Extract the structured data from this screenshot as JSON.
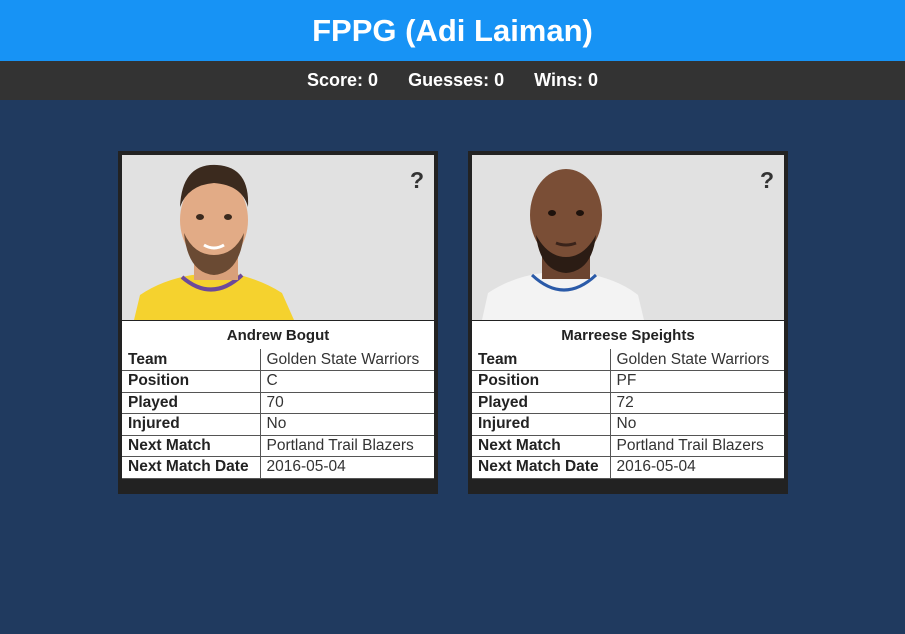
{
  "app": {
    "title": "FPPG (Adi Laiman)"
  },
  "stats": {
    "score": "Score: 0",
    "guesses": "Guesses: 0",
    "wins": "Wins: 0"
  },
  "players": [
    {
      "name": "Andrew Bogut",
      "guess_label": "?",
      "jersey_color": "#f5d22e",
      "rows": [
        {
          "label": "Team",
          "value": "Golden State Warriors"
        },
        {
          "label": "Position",
          "value": "C"
        },
        {
          "label": "Played",
          "value": "70"
        },
        {
          "label": "Injured",
          "value": "No"
        },
        {
          "label": "Next Match",
          "value": "Portland Trail Blazers"
        },
        {
          "label": "Next Match Date",
          "value": "2016-05-04"
        }
      ]
    },
    {
      "name": "Marreese Speights",
      "guess_label": "?",
      "jersey_color": "#f3f3f3",
      "rows": [
        {
          "label": "Team",
          "value": "Golden State Warriors"
        },
        {
          "label": "Position",
          "value": "PF"
        },
        {
          "label": "Played",
          "value": "72"
        },
        {
          "label": "Injured",
          "value": "No"
        },
        {
          "label": "Next Match",
          "value": "Portland Trail Blazers"
        },
        {
          "label": "Next Match Date",
          "value": "2016-05-04"
        }
      ]
    }
  ]
}
